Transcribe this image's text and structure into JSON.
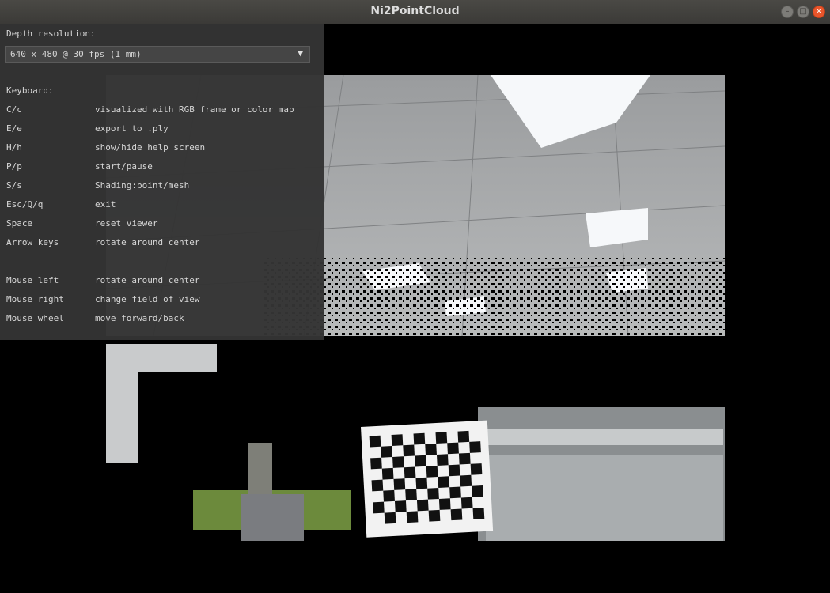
{
  "window": {
    "title": "Ni2PointCloud",
    "buttons": {
      "minimize": "–",
      "maximize": "□",
      "close": "×"
    }
  },
  "panel": {
    "depth_label": "Depth resolution:",
    "depth_value": "640 x 480 @ 30 fps (1 mm)",
    "dropdown_icon": "▼",
    "keyboard_label": "Keyboard:",
    "keyboard": [
      {
        "key": "C/c",
        "desc": "visualized with RGB frame or color map"
      },
      {
        "key": "E/e",
        "desc": "export to .ply"
      },
      {
        "key": "H/h",
        "desc": "show/hide help screen"
      },
      {
        "key": "P/p",
        "desc": "start/pause"
      },
      {
        "key": "S/s",
        "desc": "Shading:point/mesh"
      },
      {
        "key": "Esc/Q/q",
        "desc": "exit"
      },
      {
        "key": "Space",
        "desc": "reset viewer"
      },
      {
        "key": "Arrow keys",
        "desc": "rotate around center"
      }
    ],
    "mouse": [
      {
        "key": "Mouse left",
        "desc": "rotate around center"
      },
      {
        "key": "Mouse right",
        "desc": "change field of view"
      },
      {
        "key": "Mouse wheel",
        "desc": "move forward/back"
      }
    ]
  },
  "colors": {
    "titlebar": "#3b3a37",
    "panel": "#343434",
    "close": "#e9552b",
    "text": "#d6d6d6"
  }
}
